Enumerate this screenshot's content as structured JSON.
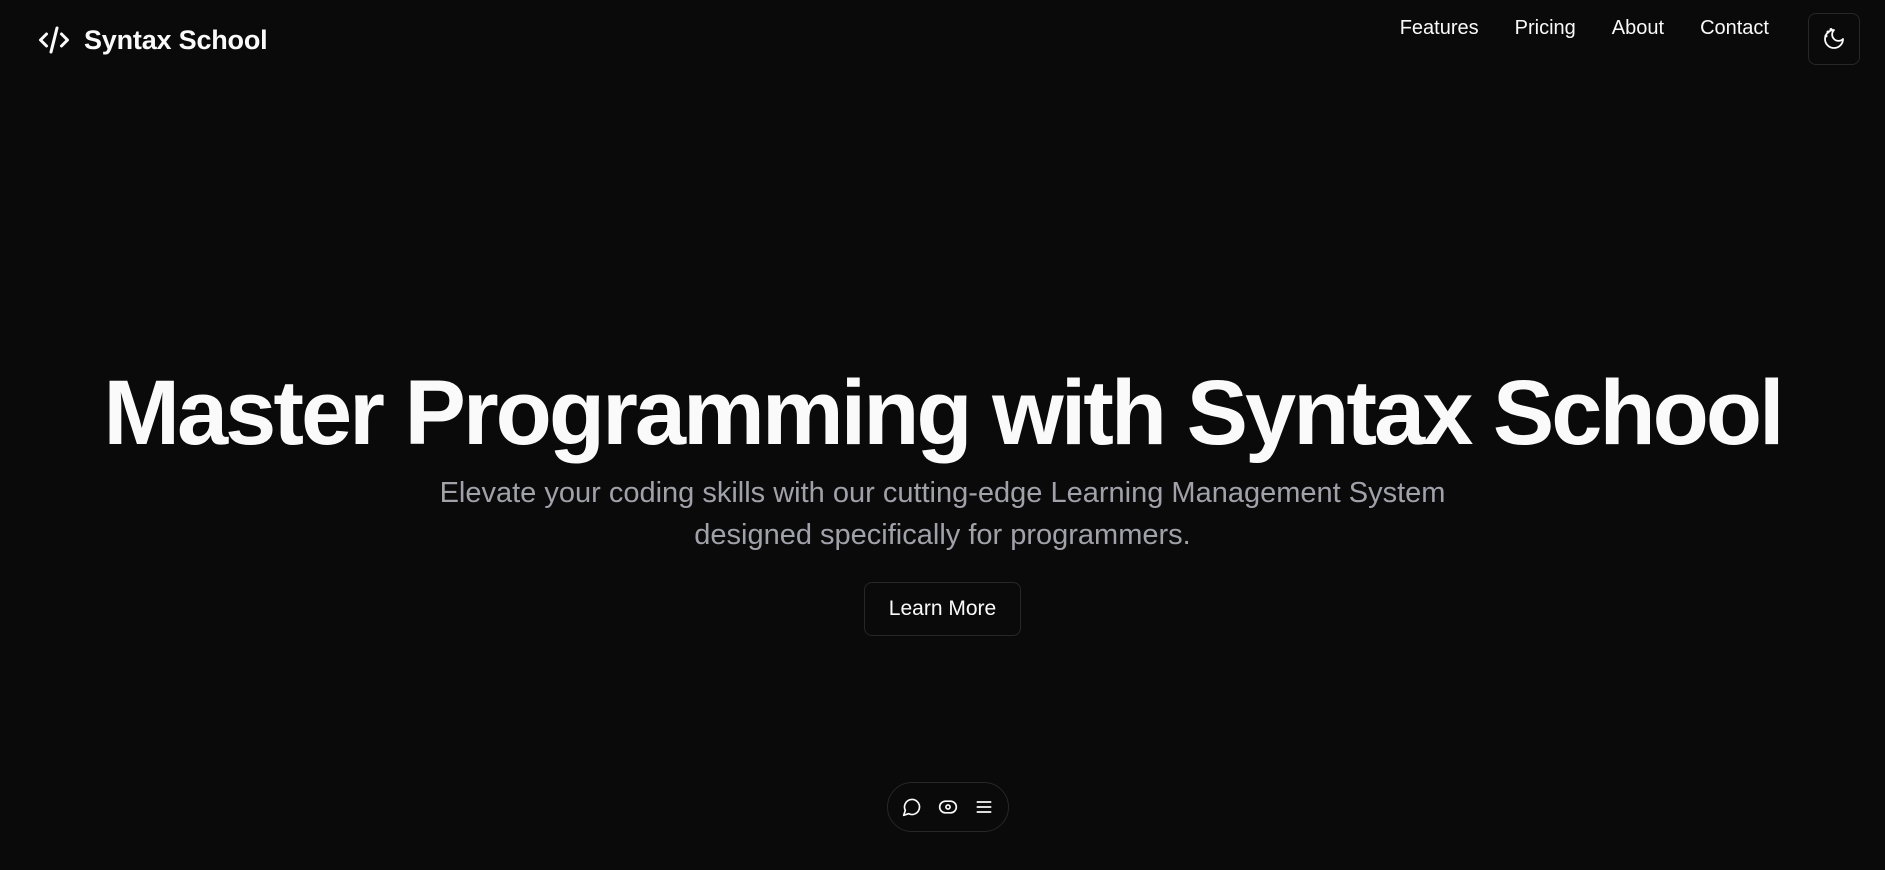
{
  "brand": {
    "name": "Syntax School",
    "icon": "code-icon"
  },
  "nav": {
    "items": [
      {
        "label": "Features"
      },
      {
        "label": "Pricing"
      },
      {
        "label": "About"
      },
      {
        "label": "Contact"
      }
    ],
    "theme_toggle_icon": "moon-stars-icon"
  },
  "hero": {
    "title": "Master Programming with Syntax School",
    "subtitle": "Elevate your coding skills with our cutting-edge Learning Management System designed specifically for programmers.",
    "cta_label": "Learn More"
  },
  "dock": {
    "icons": [
      "chat-bubble-icon",
      "eye-icon",
      "menu-icon"
    ]
  },
  "colors": {
    "background": "#0a0a0a",
    "foreground": "#fafafa",
    "muted": "#a1a1aa",
    "border": "#27272a"
  }
}
